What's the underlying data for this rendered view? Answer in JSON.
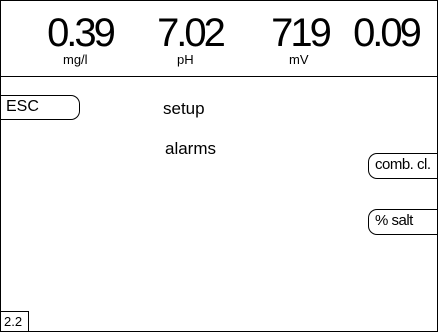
{
  "readings": [
    {
      "value": "0.39",
      "unit": "mg/l"
    },
    {
      "value": "7.02",
      "unit": "pH"
    },
    {
      "value": "719",
      "unit": "mV"
    },
    {
      "value": "0.09",
      "unit": ""
    }
  ],
  "nav": {
    "esc_label": "ESC"
  },
  "menu": {
    "items": [
      {
        "label": "setup"
      },
      {
        "label": "alarms"
      }
    ]
  },
  "side_buttons": [
    {
      "label": "comb. cl."
    },
    {
      "label": "% salt"
    }
  ],
  "footer": {
    "page_number": "2.2"
  }
}
